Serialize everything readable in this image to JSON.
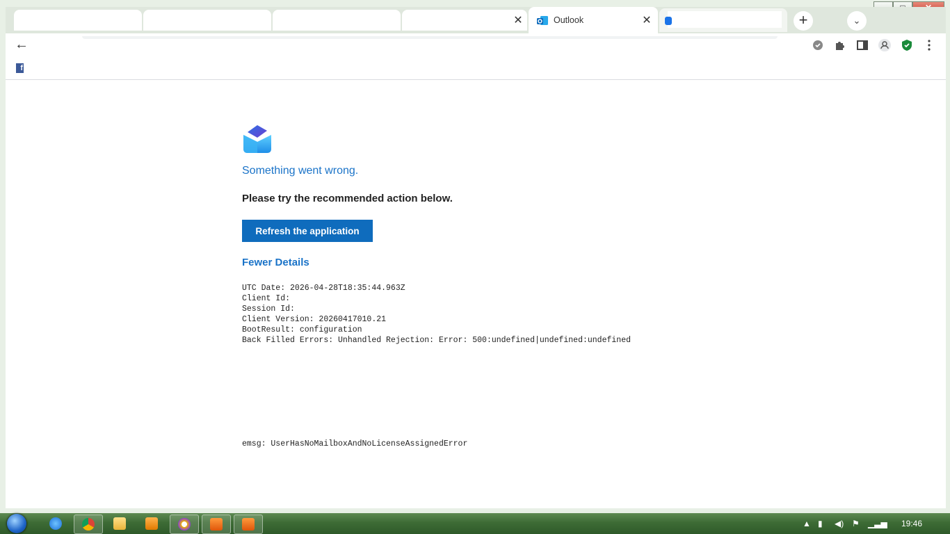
{
  "browser": {
    "active_tab_title": "Outlook",
    "tab_close_glyph": "✕",
    "new_tab_glyph": "+",
    "tab_search_glyph": "⌄",
    "back_glyph": "←",
    "toolbar_icons": [
      "gear-badge-icon",
      "puzzle-icon",
      "side-panel-icon",
      "profile-icon",
      "shield-icon",
      "menu-icon"
    ],
    "window_controls": {
      "minimize": "—",
      "maximize": "□",
      "close": "✕"
    }
  },
  "page": {
    "heading": "Something went wrong.",
    "subheading": "Please try the recommended action below.",
    "refresh_button": "Refresh the application",
    "details_link": "Fewer Details",
    "details": {
      "utc_date": "UTC Date: 2026-04-28T18:35:44.963Z",
      "client_id": "Client Id:",
      "session_id": "Session Id:",
      "client_version": "Client Version: 20260417010.21",
      "boot_result": "BootResult: configuration",
      "back_filled_errors": "Back Filled Errors: Unhandled Rejection: Error: 500:undefined|undefined:undefined"
    },
    "emsg": "emsg: UserHasNoMailboxAndNoLicenseAssignedError"
  },
  "taskbar": {
    "clock": "19:46"
  },
  "colors": {
    "accent_blue": "#0f6cbd",
    "link_blue": "#1a73c8"
  }
}
